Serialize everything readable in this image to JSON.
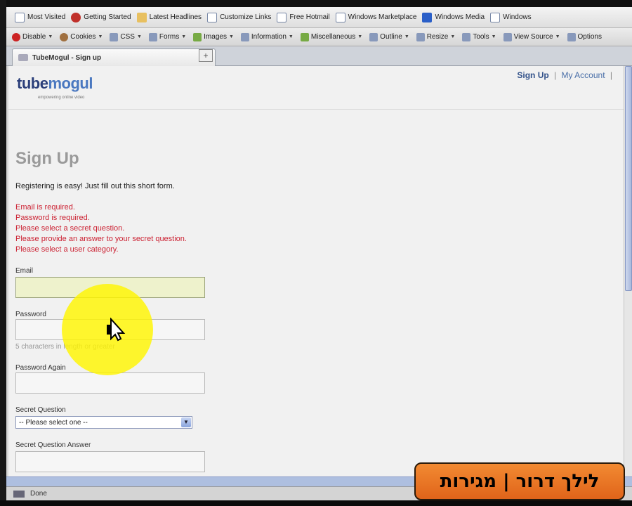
{
  "bookmarks": [
    {
      "label": "Most Visited",
      "icon": "page-icon"
    },
    {
      "label": "Getting Started",
      "icon": "firefox-icon"
    },
    {
      "label": "Latest Headlines",
      "icon": "rss-folder-icon"
    },
    {
      "label": "Customize Links",
      "icon": "page-icon"
    },
    {
      "label": "Free Hotmail",
      "icon": "page-icon"
    },
    {
      "label": "Windows Marketplace",
      "icon": "page-icon"
    },
    {
      "label": "Windows Media",
      "icon": "windows-media-icon"
    },
    {
      "label": "Windows",
      "icon": "page-icon"
    }
  ],
  "devtools": [
    {
      "label": "Disable",
      "icon": "disable-icon"
    },
    {
      "label": "Cookies",
      "icon": "cookie-icon"
    },
    {
      "label": "CSS",
      "icon": "css-icon"
    },
    {
      "label": "Forms",
      "icon": "forms-icon"
    },
    {
      "label": "Images",
      "icon": "images-icon"
    },
    {
      "label": "Information",
      "icon": "information-icon"
    },
    {
      "label": "Miscellaneous",
      "icon": "miscellaneous-icon"
    },
    {
      "label": "Outline",
      "icon": "outline-icon"
    },
    {
      "label": "Resize",
      "icon": "resize-icon"
    },
    {
      "label": "Tools",
      "icon": "tools-icon"
    },
    {
      "label": "View Source",
      "icon": "view-source-icon"
    },
    {
      "label": "Options",
      "icon": "options-icon"
    }
  ],
  "tab": {
    "title": "TubeMogul - Sign up",
    "new_tab": "+"
  },
  "header": {
    "logo_tube": "tube",
    "logo_mogul": "mogul",
    "logo_tagline": "empowering online video",
    "signup_link": "Sign Up",
    "separator": "|",
    "account_link": "My Account",
    "trailing_separator": "|"
  },
  "form": {
    "title": "Sign Up",
    "intro": "Registering is easy! Just fill out this short form.",
    "errors": [
      "Email is required.",
      "Password is required.",
      "Please select a secret question.",
      "Please provide an answer to your secret question.",
      "Please select a user category."
    ],
    "email_label": "Email",
    "password_label": "Password",
    "password_hint": "5 characters in length or greater",
    "password_again_label": "Password Again",
    "secret_question_label": "Secret Question",
    "secret_question_value": "-- Please select one --",
    "secret_answer_label": "Secret Question Answer"
  },
  "status": {
    "text": "Done"
  },
  "watermark": {
    "text": "לילך דרור | מגירות"
  },
  "colors": {
    "error": "#cc2233",
    "link": "#4a6fa8",
    "highlight_field": "#eef2cc",
    "cursor_highlight": "#fff500",
    "watermark": "#f28a32"
  }
}
